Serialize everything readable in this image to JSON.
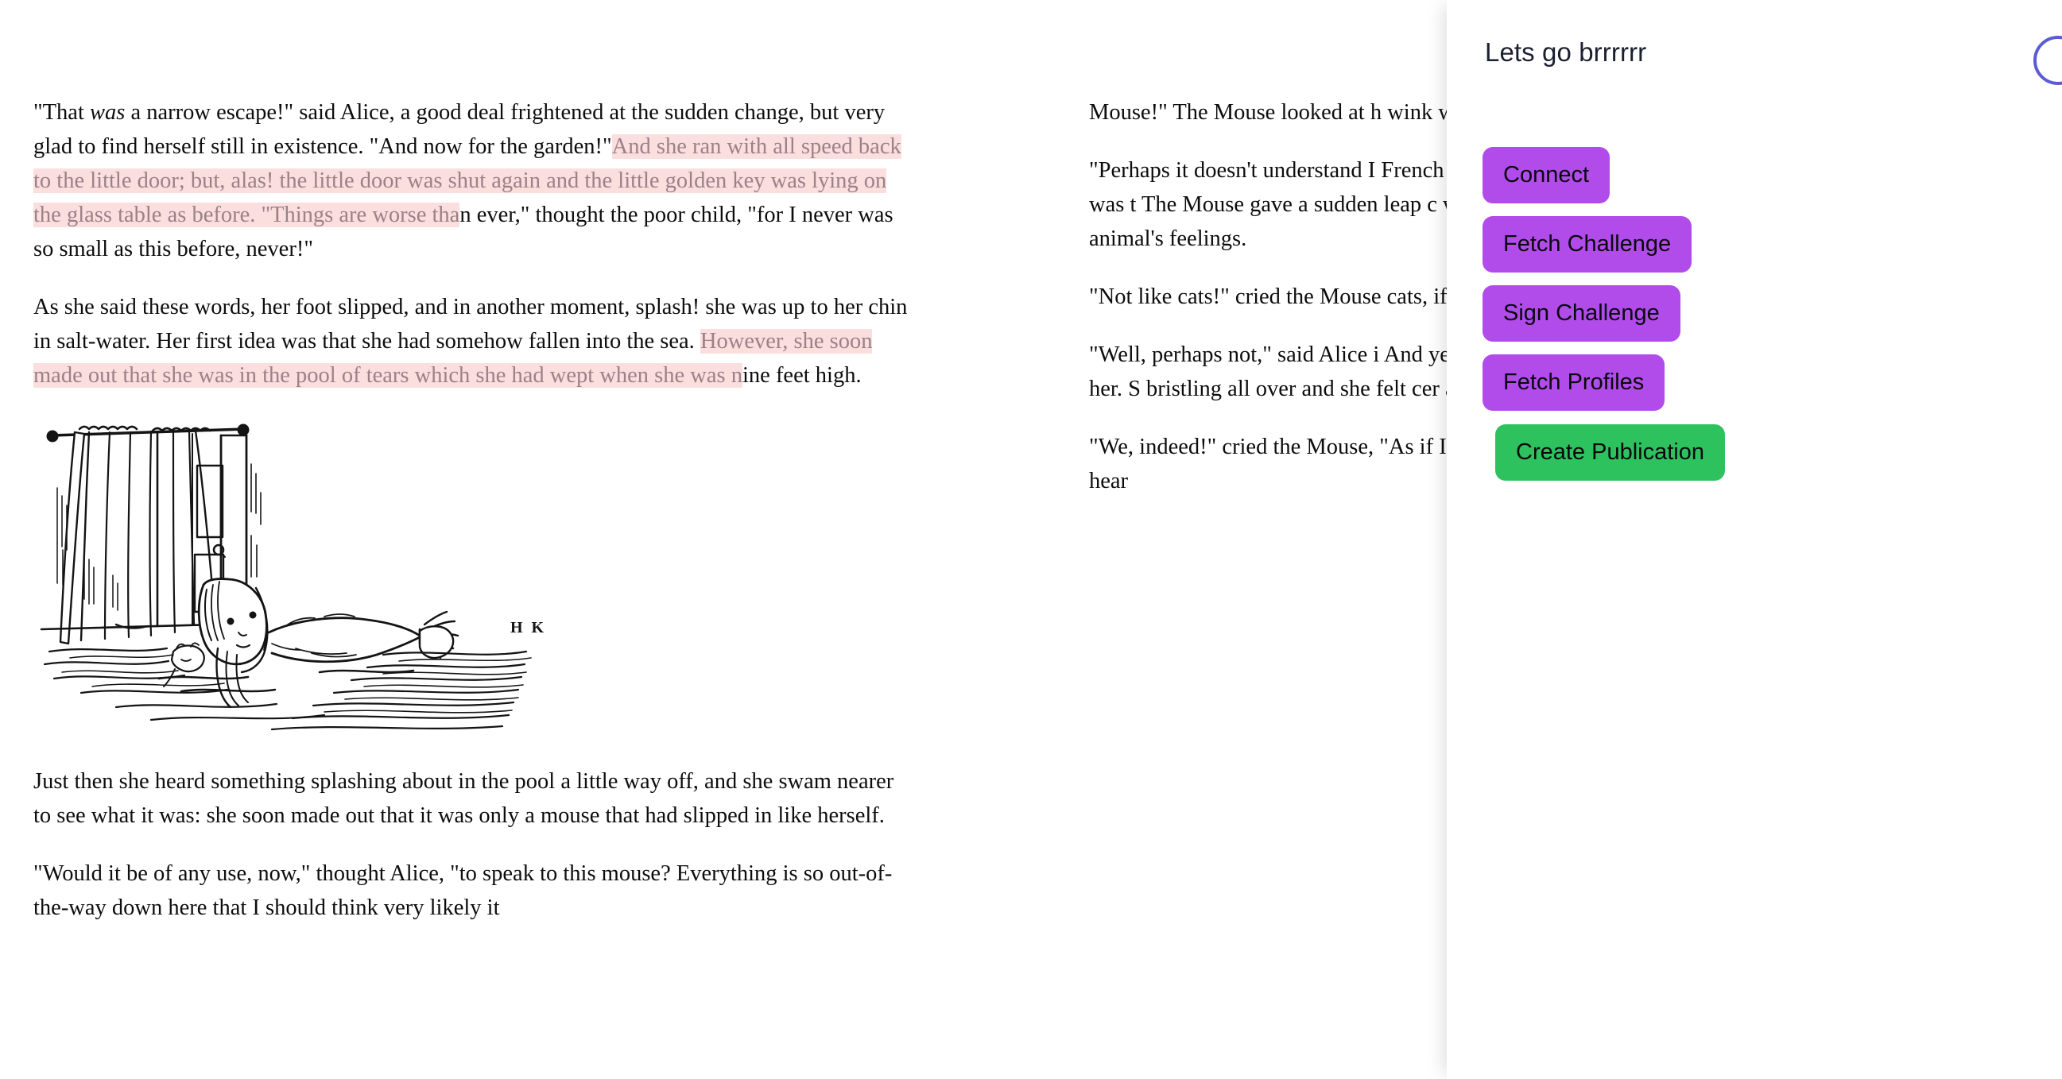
{
  "panel": {
    "title": "Lets go brrrrrr",
    "corner_pill_color": "#5b5bd6",
    "purple_color": "#b14ceb",
    "green_color": "#2ec25e",
    "buttons": [
      {
        "label": "Connect",
        "style": "purple"
      },
      {
        "label": "Fetch Challenge",
        "style": "purple"
      },
      {
        "label": "Sign Challenge",
        "style": "purple"
      },
      {
        "label": "Fetch Profiles",
        "style": "purple"
      },
      {
        "label": "Create Publication",
        "style": "green"
      }
    ]
  },
  "reader": {
    "highlight_color": "#fbdede",
    "highlight_text_color": "#9a8288",
    "left_column": {
      "p1_a": "\"That ",
      "p1_b": "was",
      "p1_c": " a narrow escape!\" said Alice, a good deal frightened at the sudden change, but very glad to find herself still in existence. \"And now for the garden!\"",
      "p1_hl": "And she ran with all speed back to the little door; but, alas! the little door was shut again and the little golden key was lying on the glass table as before. \"Things are worse tha",
      "p1_d": "n ever,\" thought the poor child, \"for I never was so small as this before, never!\"",
      "p2_a": "As she said these words, her foot slipped, and in another moment, splash! she was up to her chin in salt-water. Her first idea was that she had somehow fallen into the sea. ",
      "p2_hl": "However, she soon made out that she was in the pool of tears which she had wept when she was n",
      "p2_b": "ine feet high.",
      "illustration_caption": "Alice swimming in the pool of tears beside the curtained little door",
      "illustration_signature": "H K",
      "p3": "Just then she heard something splashing about in the pool a little way off, and she swam nearer to see what it was: she soon made out that it was only a mouse that had slipped in like herself.",
      "p4": "\"Would it be of any use, now,\" thought Alice, \"to speak to this mouse? Everything is so out-of-the-way down here that I should think very likely it"
    },
    "right_column": {
      "p1": "Mouse!\" The Mouse looked at h wink with one of its little eyes, b",
      "p2": "\"Perhaps it doesn't understand I French mouse, come over with \\ \"Où est ma chatte?\" which was t The Mouse gave a sudden leap c with fright. \"Oh, I beg your pard hurt the poor animal's feelings.",
      "p3": "\"Not like cats!\" cried the Mouse cats, if you were me?\"",
      "p4": "\"Well, perhaps not,\" said Alice i And yet I wish I could show you cats, if you could only see her. S bristling all over and she felt cer about her any more, if you'd ratl",
      "p5": "\"We, indeed!\" cried the Mouse, \"As if I would talk on such a sub vulgar things! Don't let me hear"
    }
  }
}
